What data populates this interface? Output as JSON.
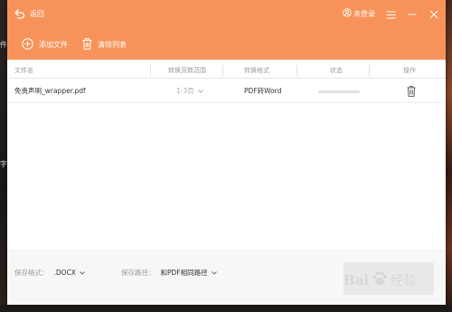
{
  "header": {
    "back_label": "返回",
    "user_label": "未登录",
    "accent_color": "#f7935a"
  },
  "toolbar": {
    "add_file_label": "添加文件",
    "clear_list_label": "清除列表"
  },
  "table": {
    "columns": [
      "文件名",
      "转换页数范围",
      "转换格式",
      "状态",
      "操作"
    ],
    "rows": [
      {
        "file_name": "免责声明_wrapper.pdf",
        "page_range": "1-3页",
        "format": "PDF转Word",
        "progress": 0
      }
    ]
  },
  "footer": {
    "save_format_label": "保存格式：",
    "save_format_value": ".DOCX",
    "save_path_label": "保存路径：",
    "save_path_value": "和PDF相同路径"
  },
  "watermark": {
    "brand": "Bai",
    "brand_suffix": "经验"
  },
  "background": {
    "edge_glyphs": [
      "件",
      "字"
    ]
  }
}
